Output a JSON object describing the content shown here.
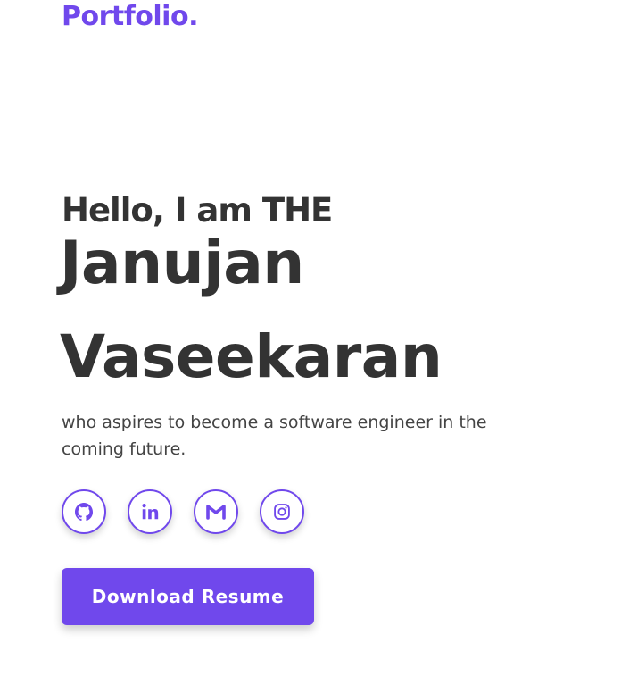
{
  "header": {
    "logo_text": "Portfolio."
  },
  "hero": {
    "greeting": "Hello, I am THE",
    "first_name": "Janujan",
    "last_name": "Vaseekaran",
    "tagline": "who aspires to become a software engineer in the coming future."
  },
  "socials": [
    {
      "icon": "github-icon"
    },
    {
      "icon": "linkedin-icon"
    },
    {
      "icon": "gmail-icon"
    },
    {
      "icon": "instagram-icon"
    }
  ],
  "cta": {
    "download_label": "Download Resume"
  },
  "colors": {
    "accent": "#7048ec",
    "text": "#333333"
  }
}
